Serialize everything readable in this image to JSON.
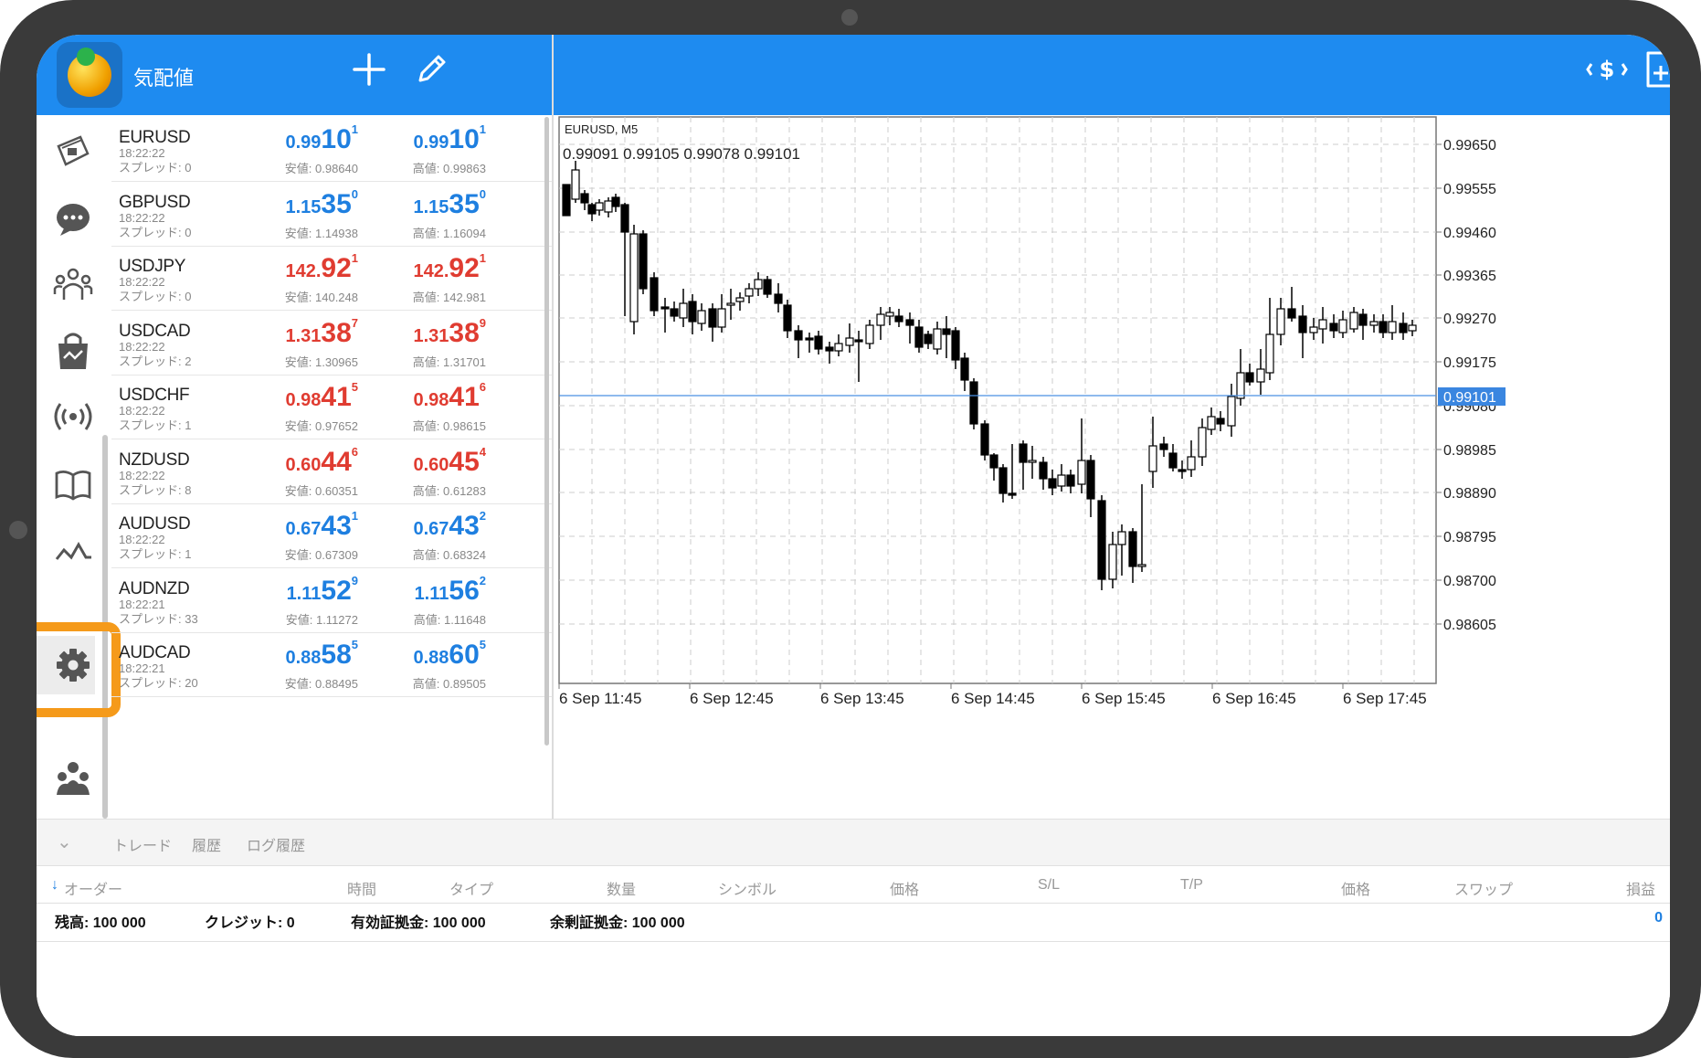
{
  "header": {
    "title": "気配値"
  },
  "quotes": [
    {
      "symbol": "EURUSD",
      "time": "18:22:22",
      "spread": "スプレッド: 0",
      "bid": {
        "small": "0.99",
        "big": "10",
        "sup": "1",
        "color": "blue"
      },
      "ask": {
        "small": "0.99",
        "big": "10",
        "sup": "1",
        "color": "blue"
      },
      "low": "安値: 0.98640",
      "high": "高値: 0.99863"
    },
    {
      "symbol": "GBPUSD",
      "time": "18:22:22",
      "spread": "スプレッド: 0",
      "bid": {
        "small": "1.15",
        "big": "35",
        "sup": "0",
        "color": "blue"
      },
      "ask": {
        "small": "1.15",
        "big": "35",
        "sup": "0",
        "color": "blue"
      },
      "low": "安値: 1.14938",
      "high": "高値: 1.16094"
    },
    {
      "symbol": "USDJPY",
      "time": "18:22:22",
      "spread": "スプレッド: 0",
      "bid": {
        "small": "142.",
        "big": "92",
        "sup": "1",
        "color": "red"
      },
      "ask": {
        "small": "142.",
        "big": "92",
        "sup": "1",
        "color": "red"
      },
      "low": "安値: 140.248",
      "high": "高値: 142.981"
    },
    {
      "symbol": "USDCAD",
      "time": "18:22:22",
      "spread": "スプレッド: 2",
      "bid": {
        "small": "1.31",
        "big": "38",
        "sup": "7",
        "color": "red"
      },
      "ask": {
        "small": "1.31",
        "big": "38",
        "sup": "9",
        "color": "red"
      },
      "low": "安値: 1.30965",
      "high": "高値: 1.31701"
    },
    {
      "symbol": "USDCHF",
      "time": "18:22:22",
      "spread": "スプレッド: 1",
      "bid": {
        "small": "0.98",
        "big": "41",
        "sup": "5",
        "color": "red"
      },
      "ask": {
        "small": "0.98",
        "big": "41",
        "sup": "6",
        "color": "red"
      },
      "low": "安値: 0.97652",
      "high": "高値: 0.98615"
    },
    {
      "symbol": "NZDUSD",
      "time": "18:22:22",
      "spread": "スプレッド: 8",
      "bid": {
        "small": "0.60",
        "big": "44",
        "sup": "6",
        "color": "red"
      },
      "ask": {
        "small": "0.60",
        "big": "45",
        "sup": "4",
        "color": "red"
      },
      "low": "安値: 0.60351",
      "high": "高値: 0.61283"
    },
    {
      "symbol": "AUDUSD",
      "time": "18:22:22",
      "spread": "スプレッド: 1",
      "bid": {
        "small": "0.67",
        "big": "43",
        "sup": "1",
        "color": "blue"
      },
      "ask": {
        "small": "0.67",
        "big": "43",
        "sup": "2",
        "color": "blue"
      },
      "low": "安値: 0.67309",
      "high": "高値: 0.68324"
    },
    {
      "symbol": "AUDNZD",
      "time": "18:22:21",
      "spread": "スプレッド: 33",
      "bid": {
        "small": "1.11",
        "big": "52",
        "sup": "9",
        "color": "blue"
      },
      "ask": {
        "small": "1.11",
        "big": "56",
        "sup": "2",
        "color": "blue"
      },
      "low": "安値: 1.11272",
      "high": "高値: 1.11648"
    },
    {
      "symbol": "AUDCAD",
      "time": "18:22:21",
      "spread": "スプレッド: 20",
      "bid": {
        "small": "0.88",
        "big": "58",
        "sup": "5",
        "color": "blue"
      },
      "ask": {
        "small": "0.88",
        "big": "60",
        "sup": "5",
        "color": "blue"
      },
      "low": "安値: 0.88495",
      "high": "高値: 0.89505"
    }
  ],
  "chart": {
    "symbol_tf": "EURUSD, M5",
    "ohlc": "0.99091 0.99105 0.99078 0.99101",
    "current_price": "0.99101",
    "y_ticks": [
      "0.99650",
      "0.99555",
      "0.99460",
      "0.99365",
      "0.99270",
      "0.99175",
      "0.99080",
      "0.98985",
      "0.98890",
      "0.98795",
      "0.98700",
      "0.98605"
    ],
    "x_ticks": [
      "6 Sep 11:45",
      "6 Sep 12:45",
      "6 Sep 13:45",
      "6 Sep 14:45",
      "6 Sep 15:45",
      "6 Sep 16:45",
      "6 Sep 17:45"
    ]
  },
  "tabs": [
    "トレード",
    "履歴",
    "ログ履歴"
  ],
  "columns": [
    "オーダー",
    "時間",
    "タイプ",
    "数量",
    "シンボル",
    "価格",
    "S/L",
    "T/P",
    "価格",
    "スワップ",
    "損益"
  ],
  "summary": {
    "balance": "残高:  100 000",
    "credit": "クレジット:  0",
    "equity": "有効証拠金:  100 000",
    "free": "余剰証拠金:  100 000",
    "pnl": "0"
  },
  "colors": {
    "accent": "#1e8bf0",
    "highlight": "#f59a1a",
    "bid_blue": "#1e7fe0",
    "ask_red": "#e03c31"
  }
}
